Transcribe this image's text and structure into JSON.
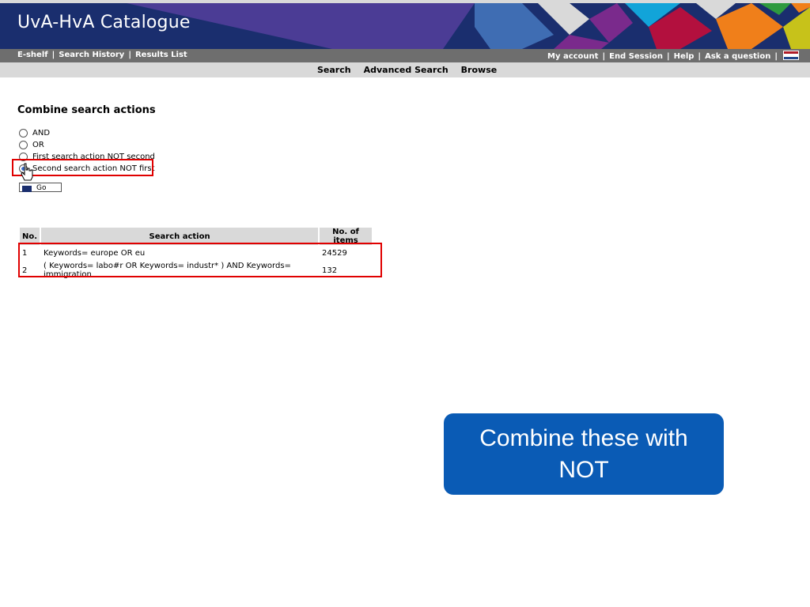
{
  "header": {
    "title": "UvA-HvA Catalogue"
  },
  "navbar": {
    "left": [
      "E-shelf",
      "Search History",
      "Results List"
    ],
    "right": [
      "My account",
      "End Session",
      "Help",
      "Ask a question"
    ]
  },
  "subnav": [
    "Search",
    "Advanced Search",
    "Browse"
  ],
  "combine": {
    "heading": "Combine search actions",
    "options": [
      "AND",
      "OR",
      "First search action NOT second",
      "Second search action NOT first"
    ],
    "selected_index": 3,
    "go_label": "Go"
  },
  "table": {
    "headers": [
      "No.",
      "Search action",
      "No. of items"
    ],
    "rows": [
      [
        "1",
        "Keywords= europe OR eu",
        "24529"
      ],
      [
        "2",
        "( Keywords= labo#r OR Keywords= industr* ) AND Keywords= immigration",
        "132"
      ]
    ]
  },
  "callout": {
    "text": "Combine these with NOT"
  },
  "colors": {
    "banner": "#1a2e6e",
    "navbar": "#6e6e6e",
    "subnav": "#d9d9d9",
    "highlight": "#e00000",
    "callout": "#0a5bb5"
  }
}
